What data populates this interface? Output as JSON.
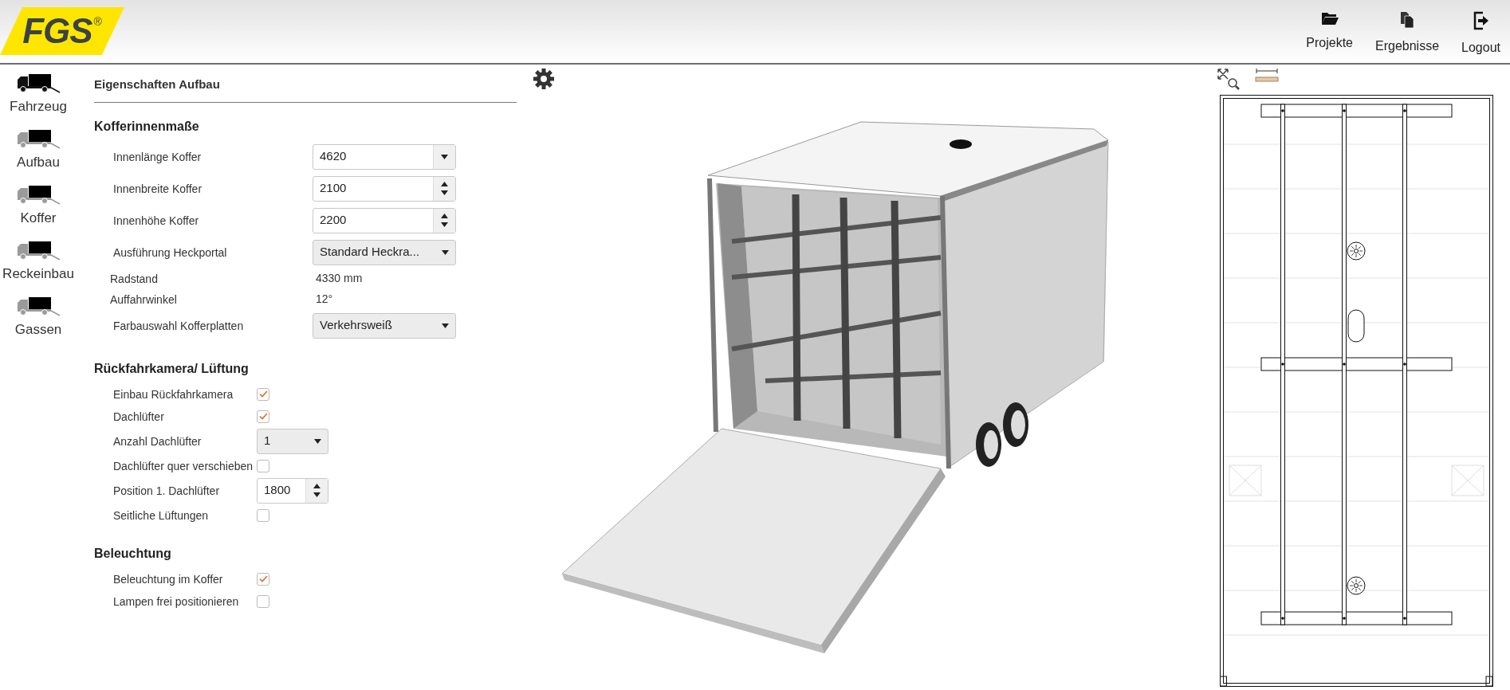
{
  "header": {
    "logo": {
      "text": "FGS",
      "mark": "®"
    },
    "nav": [
      {
        "label": "Projekte"
      },
      {
        "label": "Ergebnisse"
      },
      {
        "label": "Logout"
      }
    ]
  },
  "sidebar": {
    "items": [
      {
        "label": "Fahrzeug",
        "selected": true
      },
      {
        "label": "Aufbau",
        "selected": false
      },
      {
        "label": "Koffer",
        "selected": false
      },
      {
        "label": "Reckeinbau",
        "selected": false
      },
      {
        "label": "Gassen",
        "selected": false
      }
    ]
  },
  "panel": {
    "title": "Eigenschaften Aufbau",
    "sections": [
      {
        "heading": "Kofferinnenmaße",
        "rows": [
          {
            "kind": "combo",
            "label": "Innenlänge Koffer",
            "value": "4620"
          },
          {
            "kind": "spinner",
            "label": "Innenbreite Koffer",
            "value": "2100"
          },
          {
            "kind": "spinner",
            "label": "Innenhöhe Koffer",
            "value": "2200"
          },
          {
            "kind": "select",
            "label": "Ausführung Heckportal",
            "value": "Standard Heckra..."
          },
          {
            "kind": "readout",
            "label": "Radstand",
            "value": "4330 mm"
          },
          {
            "kind": "readout",
            "label": "Auffahrwinkel",
            "value": "12°"
          },
          {
            "kind": "select",
            "label": "Farbauswahl Kofferplatten",
            "value": "Verkehrsweiß"
          }
        ]
      },
      {
        "heading": "Rückfahrkamera/ Lüftung",
        "rows": [
          {
            "kind": "checkbox",
            "label": "Einbau Rückfahrkamera",
            "checked": true
          },
          {
            "kind": "checkbox",
            "label": "Dachlüfter",
            "checked": true
          },
          {
            "kind": "small-select",
            "label": "Anzahl Dachlüfter",
            "value": "1"
          },
          {
            "kind": "checkbox",
            "label": "Dachlüfter quer verschieben",
            "checked": false
          },
          {
            "kind": "small-spinner",
            "label": "Position 1. Dachlüfter",
            "value": "1800"
          },
          {
            "kind": "checkbox",
            "label": "Seitliche Lüftungen",
            "checked": false
          }
        ]
      },
      {
        "heading": "Beleuchtung",
        "rows": [
          {
            "kind": "checkbox",
            "label": "Beleuchtung im Koffer",
            "checked": true
          },
          {
            "kind": "checkbox",
            "label": "Lampen frei positionieren",
            "checked": false
          }
        ]
      }
    ]
  }
}
